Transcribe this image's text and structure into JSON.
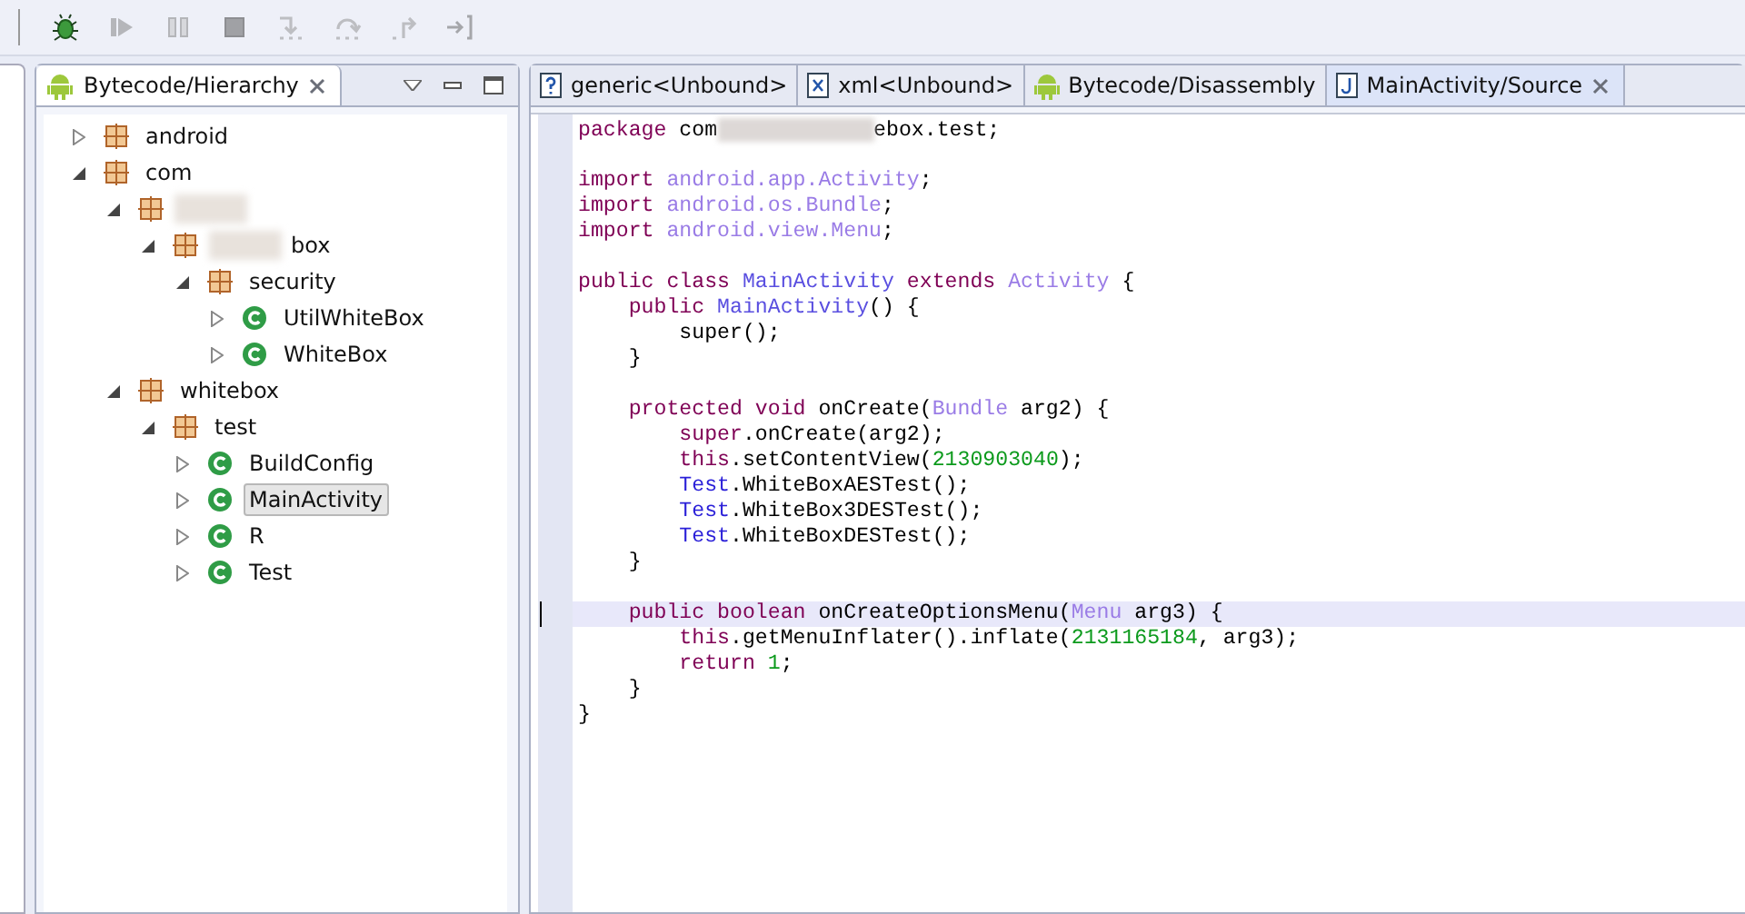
{
  "toolbar": {
    "buttons": [
      {
        "kind": "bug",
        "disabled": false
      },
      {
        "kind": "resume",
        "disabled": true
      },
      {
        "kind": "suspend",
        "disabled": true
      },
      {
        "kind": "terminate",
        "disabled": true
      },
      {
        "kind": "step_into",
        "disabled": true
      },
      {
        "kind": "step_over",
        "disabled": true
      },
      {
        "kind": "step_return",
        "disabled": true
      },
      {
        "kind": "drop_to_frame",
        "disabled": true
      }
    ]
  },
  "left_panel": {
    "tab": {
      "label": "Bytecode/Hierarchy",
      "kind": "android"
    },
    "tree": [
      {
        "label": "android",
        "kind": "package",
        "expanded": false,
        "selected": false
      },
      {
        "label": "com",
        "kind": "package",
        "expanded": true,
        "selected": false,
        "children": [
          {
            "kind": "package",
            "expanded": true,
            "selected": false,
            "redacted": true,
            "children": [
              {
                "label": "box",
                "kind": "package",
                "expanded": true,
                "selected": false,
                "redacted": true,
                "children": [
                  {
                    "label": "security",
                    "kind": "package",
                    "expanded": true,
                    "selected": false,
                    "children": [
                      {
                        "label": "UtilWhiteBox",
                        "kind": "class",
                        "expanded": false,
                        "selected": false
                      },
                      {
                        "label": "WhiteBox",
                        "kind": "class",
                        "expanded": false,
                        "selected": false
                      }
                    ]
                  }
                ]
              }
            ]
          },
          {
            "label": "whitebox",
            "kind": "package",
            "expanded": true,
            "selected": false,
            "children": [
              {
                "label": "test",
                "kind": "package",
                "expanded": true,
                "selected": false,
                "children": [
                  {
                    "label": "BuildConfig",
                    "kind": "class",
                    "expanded": false,
                    "selected": false
                  },
                  {
                    "label": "MainActivity",
                    "kind": "class",
                    "expanded": false,
                    "selected": true
                  },
                  {
                    "label": "R",
                    "kind": "class",
                    "expanded": false,
                    "selected": false
                  },
                  {
                    "label": "Test",
                    "kind": "class",
                    "expanded": false,
                    "selected": false
                  }
                ]
              }
            ]
          }
        ]
      }
    ]
  },
  "editor": {
    "tabs": [
      {
        "label": "generic<Unbound>",
        "kind": "unknown",
        "selected": false
      },
      {
        "label": "xml<Unbound>",
        "kind": "xml",
        "selected": false
      },
      {
        "label": "Bytecode/Disassembly",
        "kind": "android",
        "selected": false
      },
      {
        "label": "MainActivity/Source",
        "kind": "java",
        "selected": true
      }
    ],
    "lines": [
      {
        "kind": "code",
        "current": false,
        "segs": [
          {
            "text": "package",
            "kind": "kw"
          },
          {
            "text": " com",
            "kind": "plain"
          },
          {
            "kind": "redact"
          },
          {
            "text": "ebox.test;",
            "kind": "plain"
          }
        ]
      },
      {
        "kind": "blank"
      },
      {
        "kind": "code",
        "current": false,
        "segs": [
          {
            "text": "import",
            "kind": "kw"
          },
          {
            "text": " android.app.Activity",
            "kind": "type"
          },
          {
            "text": ";",
            "kind": "plain"
          }
        ]
      },
      {
        "kind": "code",
        "current": false,
        "segs": [
          {
            "text": "import",
            "kind": "kw"
          },
          {
            "text": " android.os.Bundle",
            "kind": "type"
          },
          {
            "text": ";",
            "kind": "plain"
          }
        ]
      },
      {
        "kind": "code",
        "current": false,
        "segs": [
          {
            "text": "import",
            "kind": "kw"
          },
          {
            "text": " android.view.Menu",
            "kind": "type"
          },
          {
            "text": ";",
            "kind": "plain"
          }
        ]
      },
      {
        "kind": "blank"
      },
      {
        "kind": "code",
        "current": false,
        "segs": [
          {
            "text": "public class",
            "kind": "kw"
          },
          {
            "text": " MainActivity",
            "kind": "decl"
          },
          {
            "text": " extends",
            "kind": "kw"
          },
          {
            "text": " Activity",
            "kind": "type"
          },
          {
            "text": " {",
            "kind": "plain"
          }
        ]
      },
      {
        "kind": "code",
        "current": false,
        "segs": [
          {
            "text": "    public",
            "kind": "kw"
          },
          {
            "text": " MainActivity",
            "kind": "decl"
          },
          {
            "text": "() {",
            "kind": "plain"
          }
        ]
      },
      {
        "kind": "code",
        "current": false,
        "segs": [
          {
            "text": "        super();",
            "kind": "plain"
          }
        ]
      },
      {
        "kind": "code",
        "current": false,
        "segs": [
          {
            "text": "    }",
            "kind": "plain"
          }
        ]
      },
      {
        "kind": "blank"
      },
      {
        "kind": "code",
        "current": false,
        "segs": [
          {
            "text": "    protected void",
            "kind": "kw"
          },
          {
            "text": " onCreate(",
            "kind": "plain"
          },
          {
            "text": "Bundle",
            "kind": "type"
          },
          {
            "text": " arg2) {",
            "kind": "plain"
          }
        ]
      },
      {
        "kind": "code",
        "current": false,
        "segs": [
          {
            "text": "        super",
            "kind": "kw"
          },
          {
            "text": ".onCreate(arg2);",
            "kind": "plain"
          }
        ]
      },
      {
        "kind": "code",
        "current": false,
        "segs": [
          {
            "text": "        this",
            "kind": "kw"
          },
          {
            "text": ".setContentView(",
            "kind": "plain"
          },
          {
            "text": "2130903040",
            "kind": "num"
          },
          {
            "text": ");",
            "kind": "plain"
          }
        ]
      },
      {
        "kind": "code",
        "current": false,
        "segs": [
          {
            "text": "        Test",
            "kind": "static"
          },
          {
            "text": ".WhiteBoxAESTest();",
            "kind": "plain"
          }
        ]
      },
      {
        "kind": "code",
        "current": false,
        "segs": [
          {
            "text": "        Test",
            "kind": "static"
          },
          {
            "text": ".WhiteBox3DESTest();",
            "kind": "plain"
          }
        ]
      },
      {
        "kind": "code",
        "current": false,
        "segs": [
          {
            "text": "        Test",
            "kind": "static"
          },
          {
            "text": ".WhiteBoxDESTest();",
            "kind": "plain"
          }
        ]
      },
      {
        "kind": "code",
        "current": false,
        "segs": [
          {
            "text": "    }",
            "kind": "plain"
          }
        ]
      },
      {
        "kind": "blank"
      },
      {
        "kind": "code",
        "current": true,
        "segs": [
          {
            "text": "    public boolean",
            "kind": "kw"
          },
          {
            "text": " onCreateOptionsMenu(",
            "kind": "plain"
          },
          {
            "text": "Menu",
            "kind": "type"
          },
          {
            "text": " arg3) {",
            "kind": "plain"
          }
        ]
      },
      {
        "kind": "code",
        "current": false,
        "segs": [
          {
            "text": "        this",
            "kind": "kw"
          },
          {
            "text": ".getMenuInflater().inflate(",
            "kind": "plain"
          },
          {
            "text": "2131165184",
            "kind": "num"
          },
          {
            "text": ", arg3);",
            "kind": "plain"
          }
        ]
      },
      {
        "kind": "code",
        "current": false,
        "segs": [
          {
            "text": "        return",
            "kind": "kw"
          },
          {
            "text": " 1",
            "kind": "num"
          },
          {
            "text": ";",
            "kind": "plain"
          }
        ]
      },
      {
        "kind": "code",
        "current": false,
        "segs": [
          {
            "text": "    }",
            "kind": "plain"
          }
        ]
      },
      {
        "kind": "code",
        "current": false,
        "segs": [
          {
            "text": "}",
            "kind": "plain"
          }
        ]
      }
    ]
  }
}
